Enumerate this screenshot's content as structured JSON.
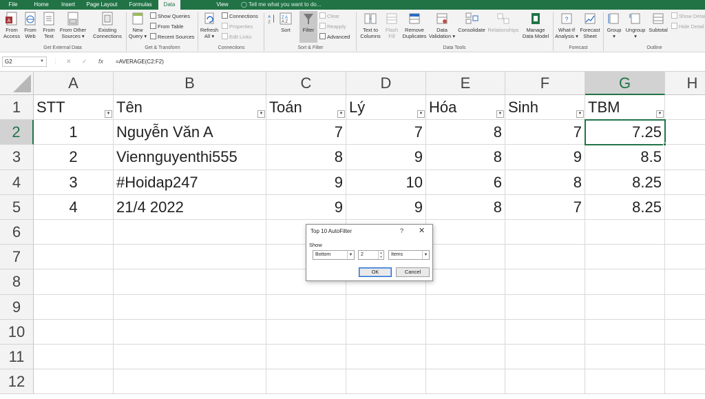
{
  "tabs": [
    "File",
    "Home",
    "Insert",
    "Page Layout",
    "Formulas",
    "Data",
    "View"
  ],
  "active_tab": "Data",
  "tell_me": "Tell me what you want to do...",
  "ribbon": {
    "from_access": "From\nAccess",
    "from_web": "From\nWeb",
    "from_text": "From\nText",
    "from_other": "From Other\nSources ▾",
    "existing_connections": "Existing\nConnections",
    "new_query": "New\nQuery ▾",
    "show_queries": "Show Queries",
    "from_table": "From Table",
    "recent_sources": "Recent Sources",
    "refresh_all": "Refresh\nAll ▾",
    "connections": "Connections",
    "properties": "Properties",
    "edit_links": "Edit Links",
    "sort": "Sort",
    "filter": "Filter",
    "clear": "Clear",
    "reapply": "Reapply",
    "advanced": "Advanced",
    "text_to_columns": "Text to\nColumns",
    "flash_fill": "Flash\nFill",
    "remove_duplicates": "Remove\nDuplicates",
    "data_validation": "Data\nValidation ▾",
    "consolidate": "Consolidate",
    "relationships": "Relationships",
    "manage_data_model": "Manage\nData Model",
    "what_if": "What-If\nAnalysis ▾",
    "forecast_sheet": "Forecast\nSheet",
    "group": "Group\n▾",
    "ungroup": "Ungroup\n▾",
    "subtotal": "Subtotal",
    "show_detail": "Show Detail",
    "hide_detail": "Hide Detail",
    "groups": {
      "get_external": "Get External Data",
      "get_transform": "Get & Transform",
      "connections": "Connections",
      "sort_filter": "Sort & Filter",
      "data_tools": "Data Tools",
      "forecast": "Forecast",
      "outline": "Outline"
    }
  },
  "formula_bar": {
    "name_box": "G2",
    "cancel": "✕",
    "enter": "✓",
    "fx": "fx",
    "formula": "=AVERAGE(C2:F2)"
  },
  "sheet": {
    "columns": [
      "A",
      "B",
      "C",
      "D",
      "E",
      "F",
      "G",
      "H"
    ],
    "rows": [
      "1",
      "2",
      "3",
      "4",
      "5",
      "6",
      "7",
      "8",
      "9",
      "10",
      "11",
      "12"
    ],
    "selected_col": "G",
    "selected_row": "2",
    "headers": [
      "STT",
      "Tên",
      "Toán",
      "Lý",
      "Hóa",
      "Sinh",
      "TBM"
    ],
    "data": [
      [
        "1",
        "Nguyễn Văn A",
        "7",
        "7",
        "8",
        "7",
        "7.25"
      ],
      [
        "2",
        "Viennguyenthi555",
        "8",
        "9",
        "8",
        "9",
        "8.5"
      ],
      [
        "3",
        "#Hoidap247",
        "9",
        "10",
        "6",
        "8",
        "8.25"
      ],
      [
        "4",
        "21/4 2022",
        "9",
        "9",
        "8",
        "7",
        "8.25"
      ]
    ]
  },
  "dialog": {
    "title": "Top 10 AutoFilter",
    "help": "?",
    "close": "✕",
    "show_label": "Show",
    "direction": "Bottom",
    "count": "2",
    "unit": "Items",
    "ok": "OK",
    "cancel": "Cancel"
  },
  "colors": {
    "accent": "#217346",
    "ribbon_bg": "#f3f3f3"
  }
}
